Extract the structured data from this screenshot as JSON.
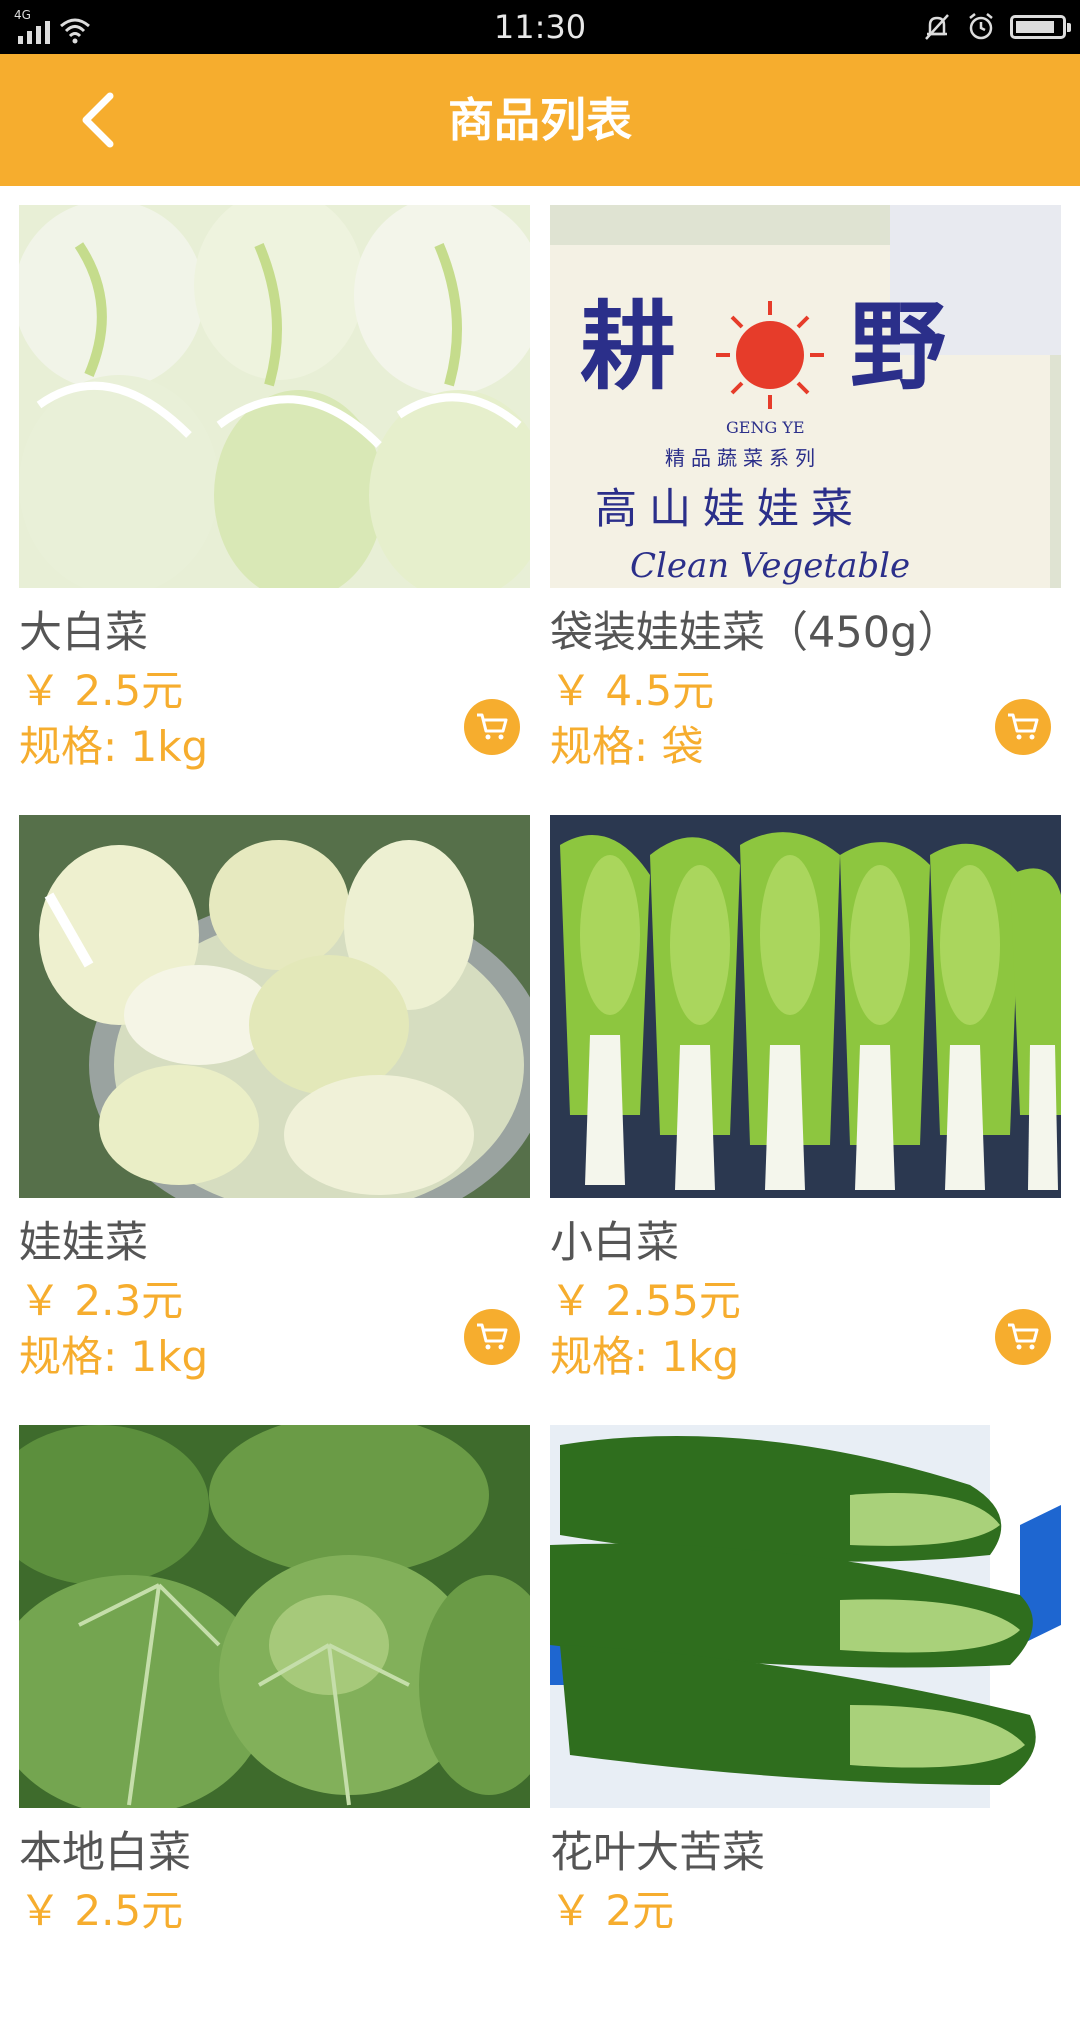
{
  "status_bar": {
    "time": "11:30",
    "network_label": "4G",
    "icons": [
      "signal-icon",
      "wifi-icon",
      "bell-muted-icon",
      "alarm-icon",
      "battery-icon"
    ]
  },
  "header": {
    "title": "商品列表",
    "back_icon": "chevron-left-icon"
  },
  "colors": {
    "accent": "#f6ad2e",
    "text_primary": "#555555",
    "status_bar": "#000000"
  },
  "products": [
    {
      "name": "大白菜",
      "price": "￥ 2.5元",
      "spec": "规格: 1kg",
      "image": "napa-cabbage-photo",
      "cart_icon": "cart-icon"
    },
    {
      "name": "袋装娃娃菜（450g）",
      "price": "￥ 4.5元",
      "spec": "规格: 袋",
      "image": "bagged-baby-cabbage-photo",
      "cart_icon": "cart-icon",
      "image_text": {
        "brand_left": "耕",
        "brand_right": "野",
        "brand_latin": "GENG YE",
        "series": "精品蔬菜系列",
        "product": "高山娃娃菜",
        "script": "Clean Vegetable"
      }
    },
    {
      "name": "娃娃菜",
      "price": "￥ 2.3元",
      "spec": "规格: 1kg",
      "image": "baby-cabbage-bowl-photo",
      "cart_icon": "cart-icon"
    },
    {
      "name": "小白菜",
      "price": "￥ 2.55元",
      "spec": "规格: 1kg",
      "image": "bok-choy-photo",
      "cart_icon": "cart-icon"
    },
    {
      "name": "本地白菜",
      "price": "￥ 2.5元",
      "spec": "",
      "image": "local-cabbage-field-photo",
      "cart_icon": "cart-icon"
    },
    {
      "name": "花叶大苦菜",
      "price": "￥ 2元",
      "spec": "",
      "image": "bitter-greens-photo",
      "cart_icon": "cart-icon"
    }
  ]
}
